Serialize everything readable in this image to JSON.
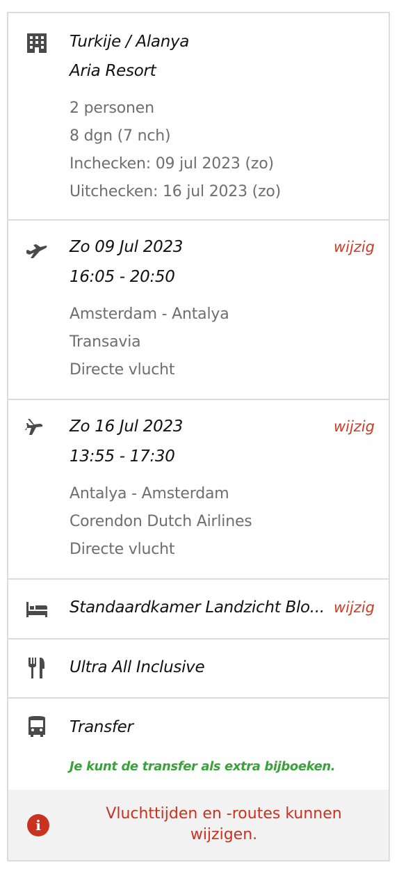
{
  "hotel": {
    "destination": "Turkije / Alanya",
    "name": "Aria Resort",
    "persons": "2 personen",
    "duration": "8 dgn (7 nch)",
    "checkin": "Inchecken: 09 jul 2023 (zo)",
    "checkout": "Uitchecken: 16 jul 2023 (zo)",
    "icon": "hotel-building-icon"
  },
  "outbound_flight": {
    "date": "Zo 09 Jul 2023",
    "time": "16:05 - 20:50",
    "route": "Amsterdam - Antalya",
    "airline": "Transavia",
    "type": "Directe vlucht",
    "edit_label": "wijzig",
    "icon": "plane-departure-icon"
  },
  "return_flight": {
    "date": "Zo 16 Jul 2023",
    "time": "13:55 - 17:30",
    "route": "Antalya - Amsterdam",
    "airline": "Corendon Dutch Airlines",
    "type": "Directe vlucht",
    "edit_label": "wijzig",
    "icon": "plane-arrival-icon"
  },
  "room": {
    "label": "Standaardkamer Landzicht Blo...",
    "edit_label": "wijzig",
    "icon": "bed-icon"
  },
  "board": {
    "label": "Ultra All Inclusive",
    "icon": "fork-knife-icon"
  },
  "transfer": {
    "label": "Transfer",
    "note": "Je kunt de transfer als extra bijboeken.",
    "icon": "bus-icon"
  },
  "notice": {
    "text": "Vluchttijden en -routes kunnen wijzigen.",
    "icon": "info-icon"
  },
  "colors": {
    "accent_red": "#d13b25",
    "green": "#3aa23a",
    "icon_gray": "#4a4a4a",
    "muted_text": "#6e6e6e",
    "border": "#dcdcdc"
  }
}
